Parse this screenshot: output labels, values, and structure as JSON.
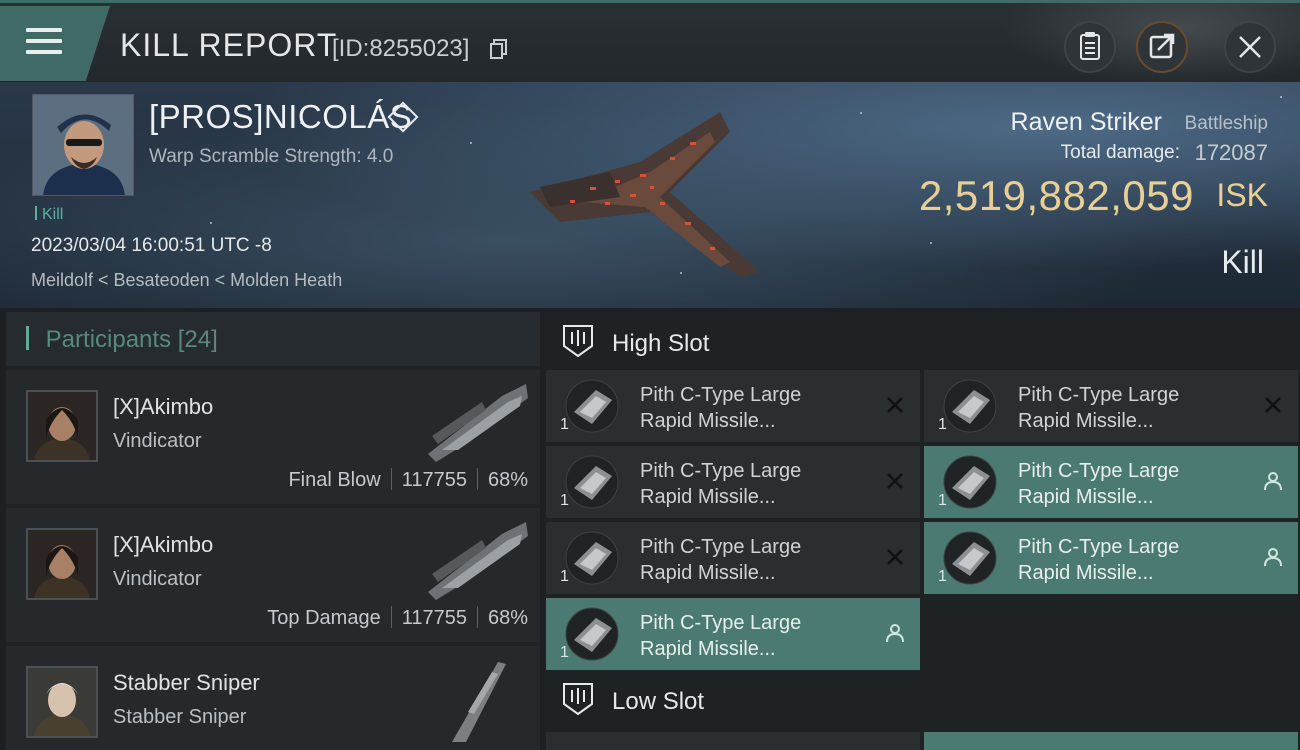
{
  "header": {
    "title": "KILL REPORT",
    "report_id": "[ID:8255023]",
    "icons": [
      "menu-icon",
      "copy-icon",
      "clipboard-icon",
      "share-icon",
      "close-icon"
    ]
  },
  "victim": {
    "name": "[PROS]NICOLÁS",
    "scram": "Warp Scramble Strength: 4.0",
    "kill_tag": "Kill",
    "datetime": "2023/03/04 16:00:51 UTC -8",
    "location": "Meildolf < Besateoden < Molden Heath",
    "ship_name": "Raven Striker",
    "ship_class": "Battleship",
    "damage_label": "Total damage:",
    "damage_value": "172087",
    "isk_value": "2,519,882,059",
    "isk_unit": "ISK",
    "result": "Kill"
  },
  "participants": {
    "title": "Participants",
    "count": "[24]",
    "rows": [
      {
        "name": "[X]Akimbo",
        "ship": "Vindicator",
        "role": "Final Blow",
        "damage": "117755",
        "percent": "68%"
      },
      {
        "name": "[X]Akimbo",
        "ship": "Vindicator",
        "role": "Top Damage",
        "damage": "117755",
        "percent": "68%"
      },
      {
        "name": "Stabber Sniper",
        "ship": "Stabber Sniper",
        "role": "",
        "damage": "",
        "percent": ""
      }
    ]
  },
  "fitting": {
    "high_slot_title": "High Slot",
    "low_slot_title": "Low Slot",
    "high_modules": [
      {
        "line1": "Pith C-Type Large",
        "line2": "Rapid Missile...",
        "qty": "1",
        "state": "destroyed"
      },
      {
        "line1": "Pith C-Type Large",
        "line2": "Rapid Missile...",
        "qty": "1",
        "state": "destroyed"
      },
      {
        "line1": "Pith C-Type Large",
        "line2": "Rapid Missile...",
        "qty": "1",
        "state": "destroyed"
      },
      {
        "line1": "Pith C-Type Large",
        "line2": "Rapid Missile...",
        "qty": "1",
        "state": "dropped"
      },
      {
        "line1": "Pith C-Type Large",
        "line2": "Rapid Missile...",
        "qty": "1",
        "state": "destroyed"
      },
      {
        "line1": "Pith C-Type Large",
        "line2": "Rapid Missile...",
        "qty": "1",
        "state": "dropped"
      },
      {
        "line1": "Pith C-Type Large",
        "line2": "Rapid Missile...",
        "qty": "1",
        "state": "dropped"
      }
    ]
  },
  "colors": {
    "accent": "#4a7a71",
    "isk": "#e8cf95",
    "participants_title": "#58897f"
  }
}
